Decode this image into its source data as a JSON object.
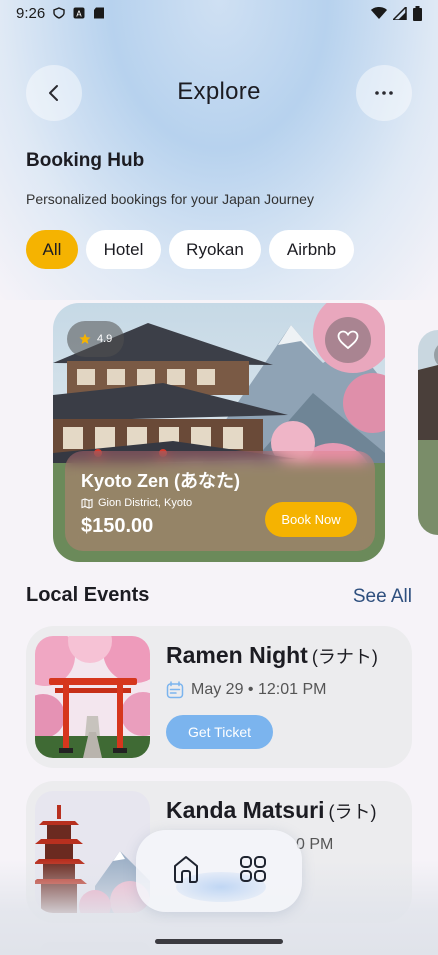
{
  "status_bar": {
    "time": "9:26"
  },
  "header": {
    "title": "Explore"
  },
  "booking_hub": {
    "title": "Booking Hub",
    "subtitle": "Personalized bookings for your Japan Journey"
  },
  "filters": [
    {
      "label": "All",
      "active": true
    },
    {
      "label": "Hotel",
      "active": false
    },
    {
      "label": "Ryokan",
      "active": false
    },
    {
      "label": "Airbnb",
      "active": false
    }
  ],
  "featured": {
    "rating": "4.9",
    "name": "Kyoto Zen (あなた)",
    "location": "Gion District, Kyoto",
    "price": "$150.00",
    "book_label": "Book Now"
  },
  "events": {
    "title": "Local Events",
    "see_all": "See All",
    "items": [
      {
        "name": "Ramen Night",
        "jp": "(ラナト)",
        "date": "May 29 • 12:01 PM",
        "button": "Get Ticket"
      },
      {
        "name": "Kanda Matsuri",
        "jp": "(ラト)",
        "date": "0 PM",
        "button": ""
      }
    ]
  },
  "colors": {
    "accent": "#f5b301",
    "ticket": "#7bb4ee",
    "link": "#2e4f7e"
  },
  "icons": [
    "back-icon",
    "more-icon",
    "star-icon",
    "heart-icon",
    "map-icon",
    "calendar-icon",
    "home-icon",
    "grid-icon"
  ]
}
